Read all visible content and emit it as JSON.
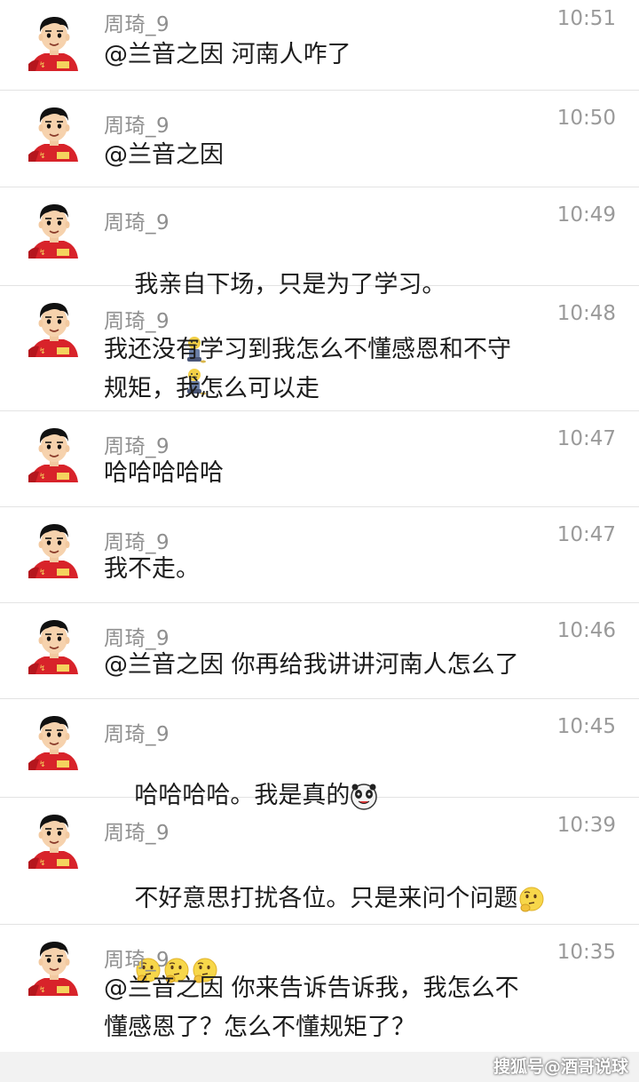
{
  "messages": [
    {
      "name": "周琦_9",
      "time": "10:51",
      "text": "@兰音之因 河南人咋了",
      "emojis": []
    },
    {
      "name": "周琦_9",
      "time": "10:50",
      "text": "@兰音之因",
      "emojis": []
    },
    {
      "name": "周琦_9",
      "time": "10:49",
      "text": "我亲自下场，只是为了学习。",
      "emojis": [
        "kneel-icon",
        "kneel-icon"
      ]
    },
    {
      "name": "周琦_9",
      "time": "10:48",
      "text": "我还没有学习到我怎么不懂感恩和不守\n规矩，我怎么可以走",
      "emojis": []
    },
    {
      "name": "周琦_9",
      "time": "10:47",
      "text": "哈哈哈哈哈",
      "emojis": []
    },
    {
      "name": "周琦_9",
      "time": "10:47",
      "text": "我不走。",
      "emojis": []
    },
    {
      "name": "周琦_9",
      "time": "10:46",
      "text": "@兰音之因 你再给我讲讲河南人怎么了",
      "emojis": []
    },
    {
      "name": "周琦_9",
      "time": "10:45",
      "text": "哈哈哈哈。我是真的",
      "emojis": [
        "panda-icon"
      ]
    },
    {
      "name": "周琦_9",
      "time": "10:39",
      "text": "不好意思打扰各位。只是来问个问题",
      "emojis": [
        "thinking-face-icon"
      ],
      "second_line_emojis": [
        "thinking-face-icon",
        "thinking-face-icon",
        "thinking-face-icon"
      ]
    },
    {
      "name": "周琦_9",
      "time": "10:35",
      "text": "@兰音之因 你来告诉告诉我，我怎么不\n懂感恩了？怎么不懂规矩了？",
      "emojis": []
    }
  ],
  "watermark": "搜狐号@酒哥说球"
}
